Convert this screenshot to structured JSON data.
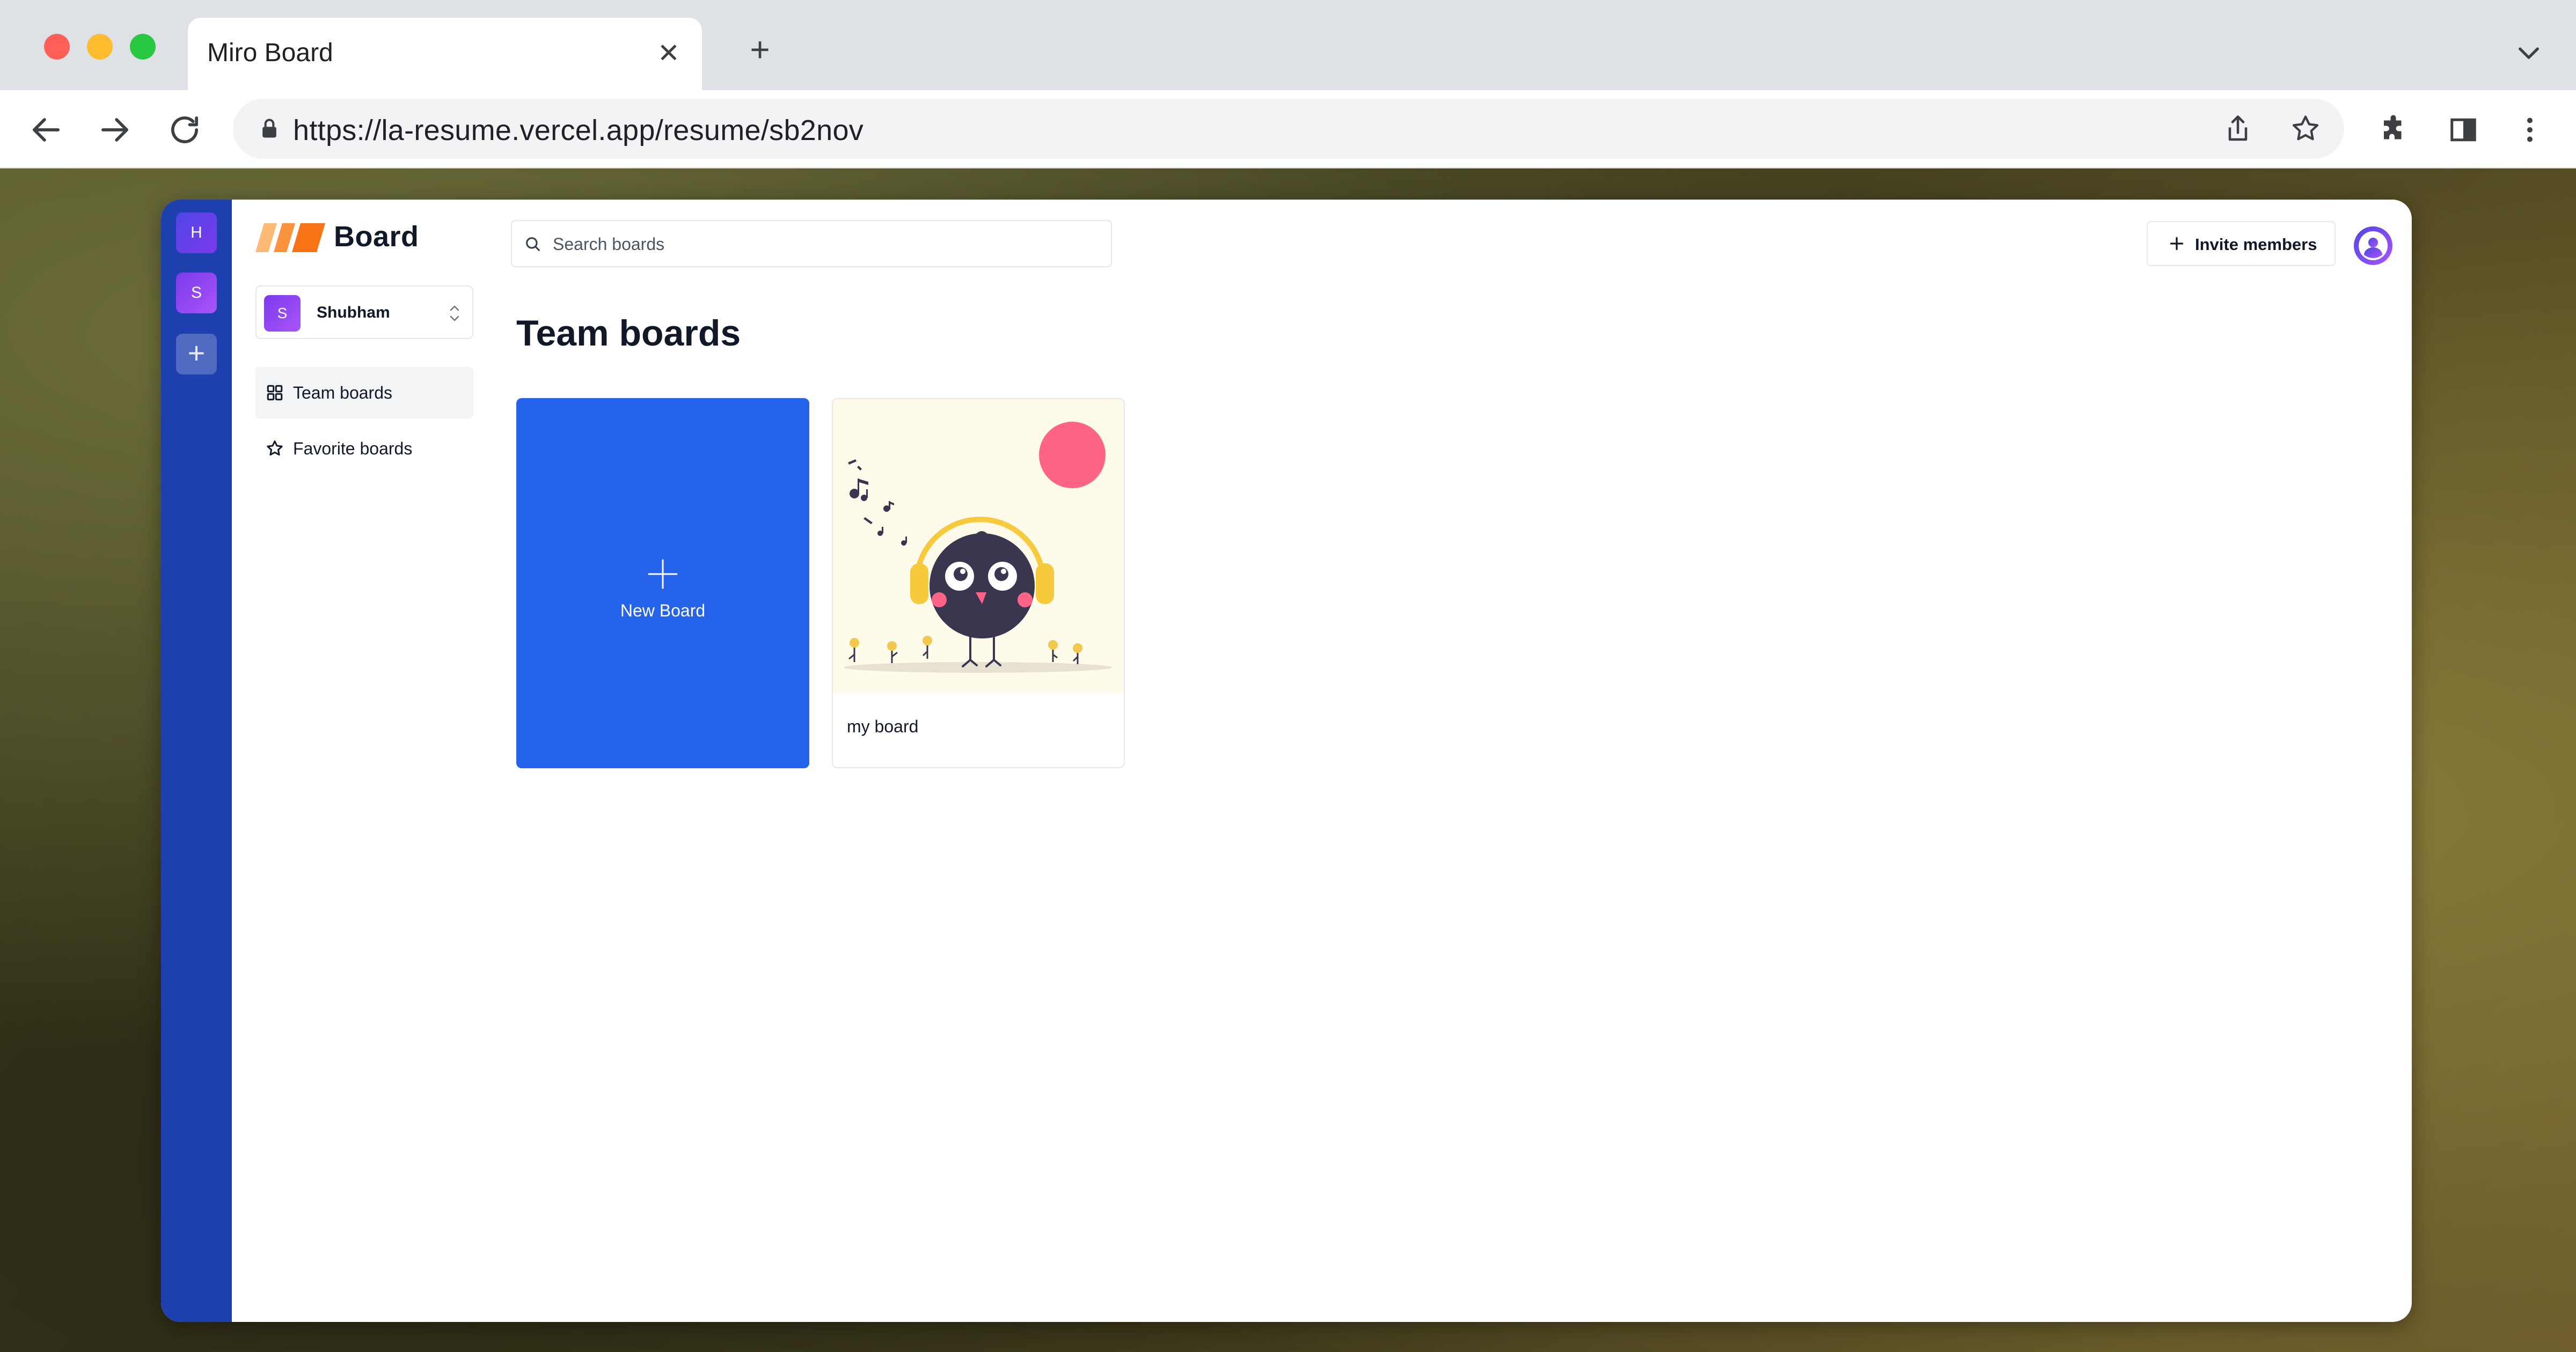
{
  "browser": {
    "tab_title": "Miro Board",
    "close_tab_glyph": "✕",
    "new_tab_glyph": "+",
    "url": "https://la-resume.vercel.app/resume/sb2nov"
  },
  "rail": {
    "orgs": [
      {
        "initial": "H"
      },
      {
        "initial": "S"
      }
    ],
    "add_glyph": "+"
  },
  "sidebar": {
    "logo_text": "Board",
    "org_switcher": {
      "initial": "S",
      "name": "Shubham"
    },
    "items": [
      {
        "label": "Team boards",
        "icon": "grid-icon",
        "active": true
      },
      {
        "label": "Favorite boards",
        "icon": "star-icon",
        "active": false
      }
    ]
  },
  "header": {
    "search_placeholder": "Search boards",
    "invite_label": "Invite members"
  },
  "main": {
    "title": "Team boards",
    "new_board_label": "New Board",
    "boards": [
      {
        "name": "my board"
      }
    ]
  },
  "colors": {
    "rail": "#1e40af",
    "primary": "#2563eb",
    "thumb_bg": "#fffbea",
    "sun": "#ff6385"
  }
}
